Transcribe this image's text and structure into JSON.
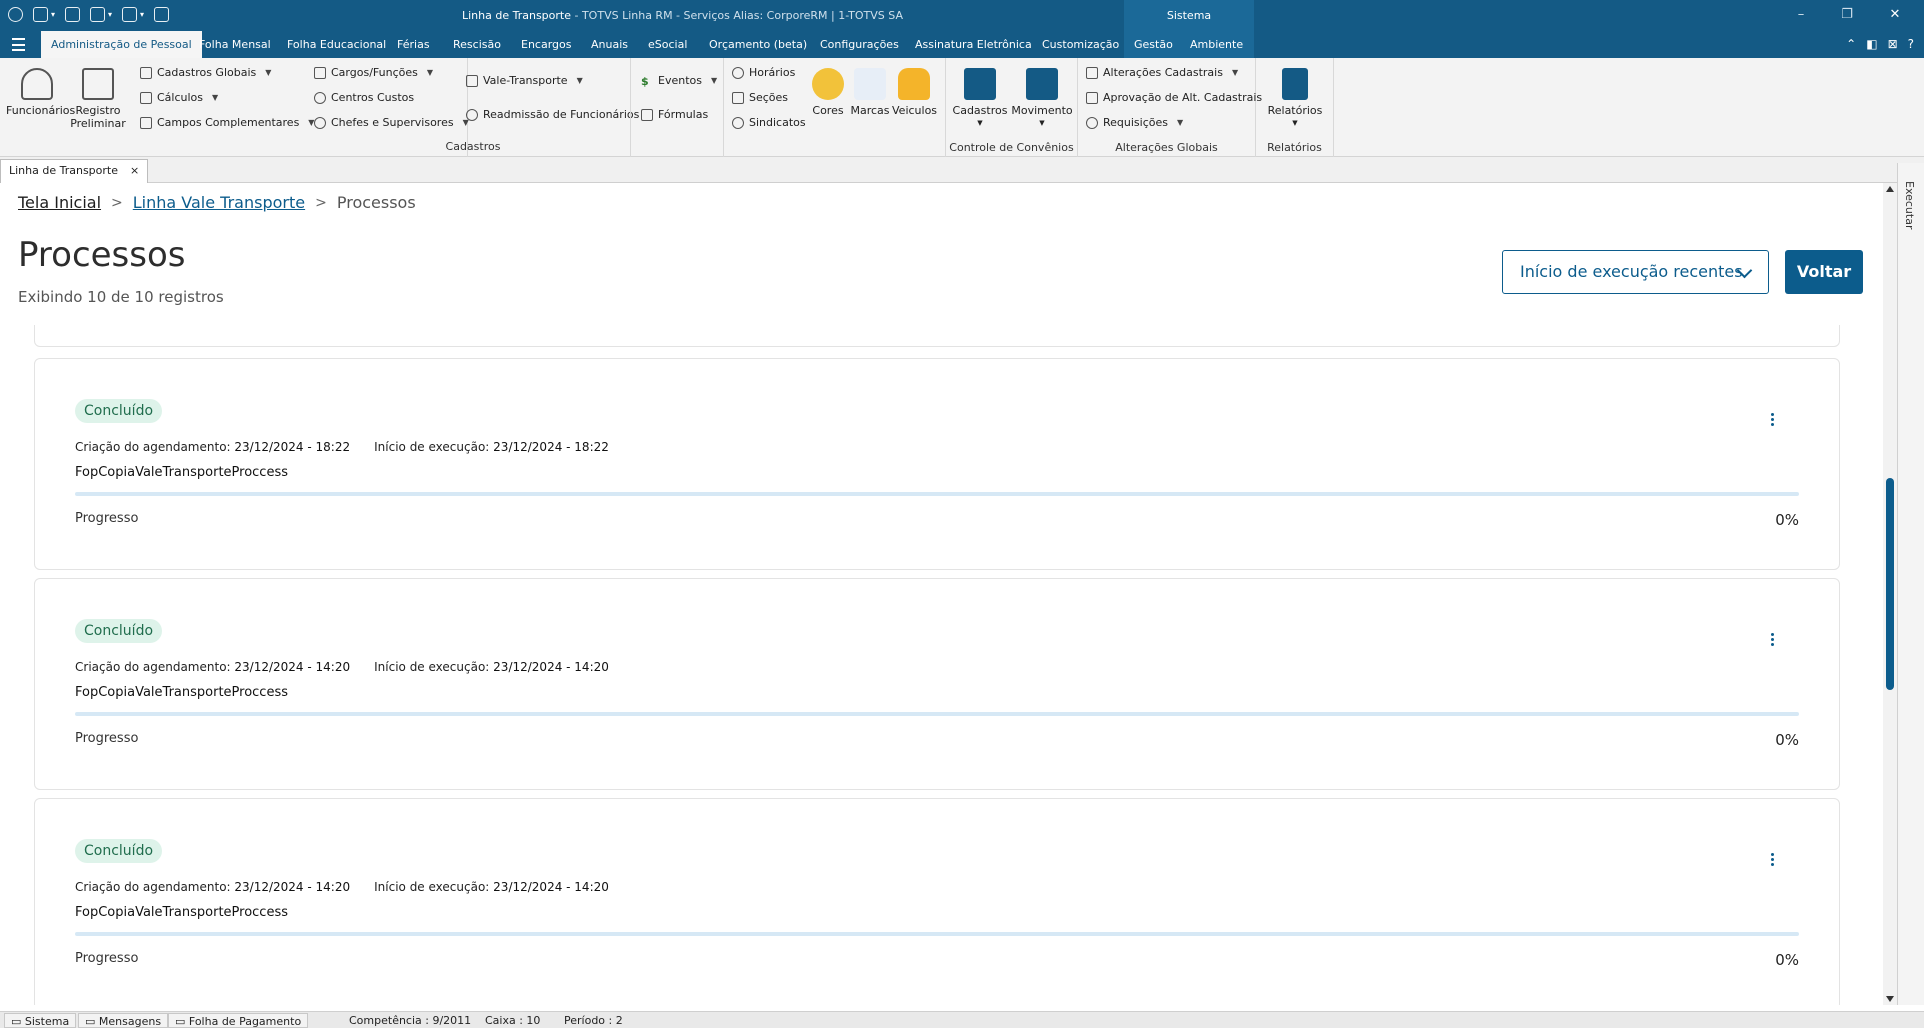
{
  "window": {
    "title": "Linha de Transporte",
    "title_suffix": "- TOTVS Linha RM - Serviços  Alias: CorporeRM | 1-TOTVS SA",
    "system_tab": "Sistema"
  },
  "ribbon_tabs": [
    "Administração de Pessoal",
    "Folha Mensal",
    "Folha Educacional",
    "Férias",
    "Rescisão",
    "Encargos",
    "Anuais",
    "eSocial",
    "Orçamento (beta)",
    "Configurações",
    "Assinatura Eletrônica",
    "Customização",
    "Gestão",
    "Ambiente"
  ],
  "ribbon": {
    "funcionarios": "Funcionários",
    "registro": "Registro",
    "preliminar": "Preliminar",
    "cadastros_globais": "Cadastros Globais",
    "calculos": "Cálculos",
    "campos_complementares": "Campos Complementares",
    "cargos_funcoes": "Cargos/Funções",
    "centros_custos": "Centros Custos",
    "chefes_supervisores": "Chefes e Supervisores",
    "vale_transporte": "Vale-Transporte",
    "readmissao": "Readmissão de Funcionários",
    "eventos": "Eventos",
    "formulas": "Fórmulas",
    "horarios": "Horários",
    "secoes": "Seções",
    "sindicatos": "Sindicatos",
    "cores": "Cores",
    "marcas": "Marcas",
    "veiculos": "Veiculos",
    "cadastros_group": "Cadastros",
    "conv_cadastros": "Cadastros",
    "conv_movimento": "Movimento",
    "controle_convenios": "Controle de Convênios",
    "alteracoes_cadastrais": "Alterações Cadastrais",
    "aprovacao_alt": "Aprovação de Alt. Cadastrais",
    "requisicoes": "Requisições",
    "alteracoes_globais": "Alterações Globais",
    "relatorios_btn": "Relatórios",
    "relatorios_group": "Relatórios"
  },
  "doc_tab": {
    "label": "Linha de Transporte",
    "close": "×"
  },
  "breadcrumb": {
    "home": "Tela Inicial",
    "parent": "Linha Vale Transporte",
    "current": "Processos",
    "sep": ">"
  },
  "page": {
    "title": "Processos",
    "count": "Exibindo 10 de 10 registros",
    "sort_label": "Início de execução recentes",
    "back_label": "Voltar"
  },
  "processes": [
    {
      "status": "Concluído",
      "created_label": "Criação do agendamento:",
      "created": "23/12/2024 - 18:22",
      "start_label": "Início de execução:",
      "start": "23/12/2024 - 18:22",
      "name": "FopCopiaValeTransporteProccess",
      "progress_label": "Progresso",
      "progress": 0,
      "progress_text": "0%"
    },
    {
      "status": "Concluído",
      "created_label": "Criação do agendamento:",
      "created": "23/12/2024 - 14:20",
      "start_label": "Início de execução:",
      "start": "23/12/2024 - 14:20",
      "name": "FopCopiaValeTransporteProccess",
      "progress_label": "Progresso",
      "progress": 0,
      "progress_text": "0%"
    },
    {
      "status": "Concluído",
      "created_label": "Criação do agendamento:",
      "created": "23/12/2024 - 14:20",
      "start_label": "Início de execução:",
      "start": "23/12/2024 - 14:20",
      "name": "FopCopiaValeTransporteProccess",
      "progress_label": "Progresso",
      "progress": 0,
      "progress_text": "0%"
    }
  ],
  "side_panel": {
    "label": "Executar"
  },
  "statusbar": {
    "sistema": "Sistema",
    "mensagens": "Mensagens",
    "folha": "Folha de Pagamento",
    "competencia": "Competência : 9/2011",
    "caixa": "Caixa : 10",
    "periodo": "Período : 2"
  },
  "colors": {
    "brand": "#145a85",
    "accent": "#0c5c8c",
    "success_bg": "#def3ea",
    "success_text": "#206d4d"
  }
}
